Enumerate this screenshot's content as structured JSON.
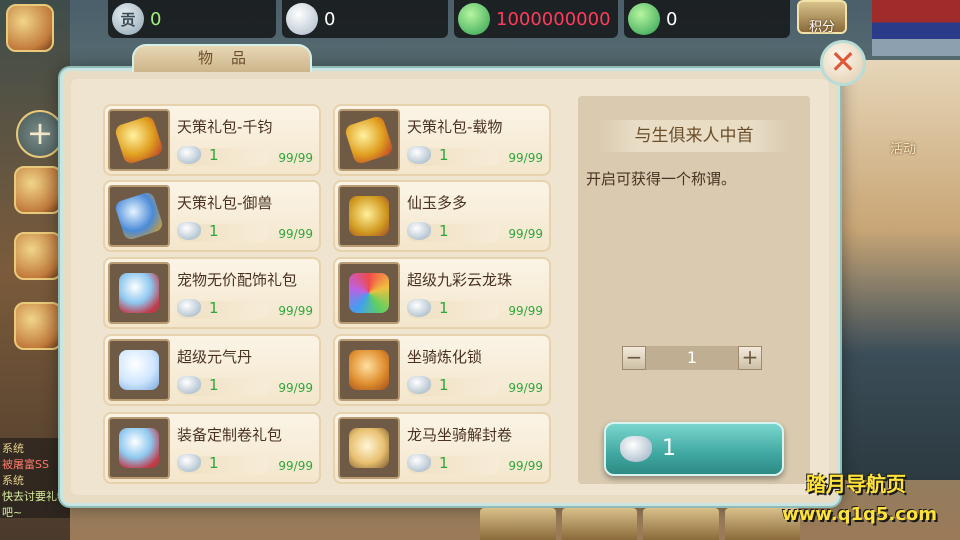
{
  "currency": {
    "tribute_icon": "贡",
    "tribute": "0",
    "silver": "0",
    "jade": "1000000000",
    "jade_locked": "0",
    "score_label": "积分"
  },
  "side": {
    "activity_label": "活动",
    "chat": [
      {
        "tag": "系统",
        "text": "被屠富SS"
      },
      {
        "tag": "系统",
        "text": "快去讨要礼物吧~"
      }
    ]
  },
  "dialog": {
    "title": "物品",
    "close_symbol": "✕"
  },
  "items": [
    {
      "name": "天策礼包-千钧",
      "price": "1",
      "stock": "99/99",
      "icon": "gold-giftbox-icon"
    },
    {
      "name": "天策礼包-载物",
      "price": "1",
      "stock": "99/99",
      "icon": "gold-giftbox-icon"
    },
    {
      "name": "天策礼包-御兽",
      "price": "1",
      "stock": "99/99",
      "icon": "blue-giftbox-icon"
    },
    {
      "name": "仙玉多多",
      "price": "1",
      "stock": "99/99",
      "icon": "jade-bag-icon"
    },
    {
      "name": "宠物无价配饰礼包",
      "price": "1",
      "stock": "99/99",
      "icon": "pet-accessory-bag-icon"
    },
    {
      "name": "超级九彩云龙珠",
      "price": "1",
      "stock": "99/99",
      "icon": "rainbow-dragon-pearl-icon"
    },
    {
      "name": "超级元气丹",
      "price": "1",
      "stock": "99/99",
      "icon": "vitality-pill-icon"
    },
    {
      "name": "坐骑炼化锁",
      "price": "1",
      "stock": "99/99",
      "icon": "mount-lock-icon"
    },
    {
      "name": "装备定制卷礼包",
      "price": "1",
      "stock": "99/99",
      "icon": "equipment-scroll-bag-icon"
    },
    {
      "name": "龙马坐骑解封卷",
      "price": "1",
      "stock": "99/99",
      "icon": "dragon-horse-scroll-icon"
    }
  ],
  "detail": {
    "title": "与生俱来人中首",
    "description": "开启可获得一个称谓。",
    "quantity": "1",
    "minus": "−",
    "plus": "+",
    "buy_price": "1"
  },
  "watermark": {
    "line1": "踏月导航页",
    "line2": "www.q1q5.com"
  },
  "colors": {
    "price_green": "#2ea63a",
    "jade_red": "#ff3c5c",
    "buy_teal": "#3fa8a0"
  }
}
